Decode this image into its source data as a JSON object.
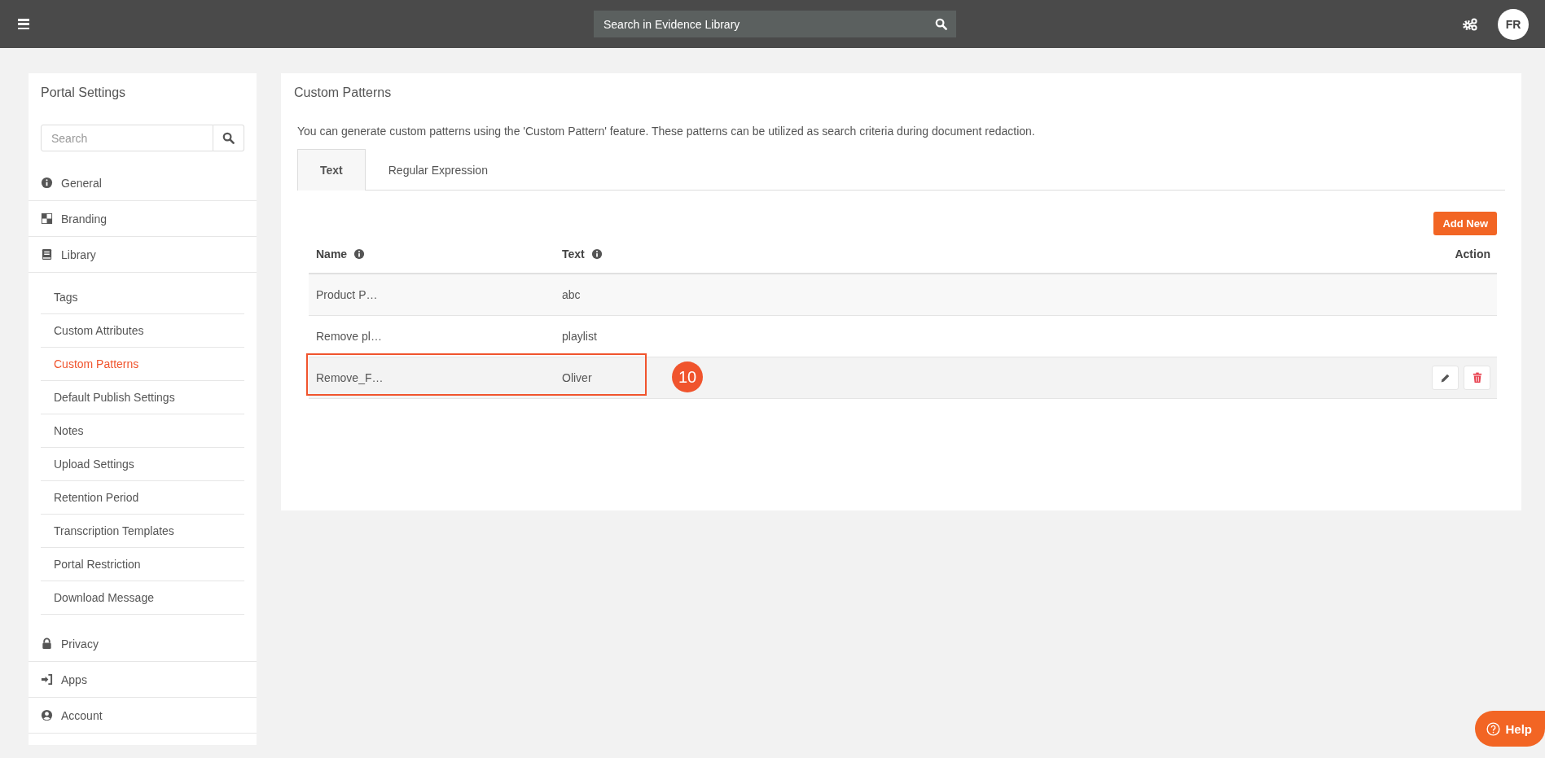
{
  "topbar": {
    "search": {
      "placeholder": "Search in Evidence Library"
    },
    "avatar": "FR"
  },
  "sidebar": {
    "title": "Portal Settings",
    "search": {
      "placeholder": "Search"
    },
    "items": [
      {
        "label": "General",
        "selected": false
      },
      {
        "label": "Branding",
        "selected": false
      },
      {
        "label": "Library",
        "selected": false,
        "children": [
          {
            "label": "Tags",
            "selected": false
          },
          {
            "label": "Custom Attributes",
            "selected": false
          },
          {
            "label": "Custom Patterns",
            "selected": true
          },
          {
            "label": "Default Publish Settings",
            "selected": false
          },
          {
            "label": "Notes",
            "selected": false
          },
          {
            "label": "Upload Settings",
            "selected": false
          },
          {
            "label": "Retention Period",
            "selected": false
          },
          {
            "label": "Transcription Templates",
            "selected": false
          },
          {
            "label": "Portal Restriction",
            "selected": false
          },
          {
            "label": "Download Message",
            "selected": false
          }
        ]
      },
      {
        "label": "Privacy",
        "selected": false
      },
      {
        "label": "Apps",
        "selected": false
      },
      {
        "label": "Account",
        "selected": false
      }
    ]
  },
  "main": {
    "title": "Custom Patterns",
    "description": "You can generate custom patterns using the 'Custom Pattern' feature. These patterns can be utilized as search criteria during document redaction.",
    "tabs": [
      {
        "label": "Text",
        "selected": true
      },
      {
        "label": "Regular Expression",
        "selected": false
      }
    ],
    "add_button": "Add New",
    "table": {
      "columns": [
        "Name",
        "Text",
        "Action"
      ],
      "rows": [
        {
          "name": "Product P…",
          "text": "abc",
          "actions_visible": false,
          "highlighted": false
        },
        {
          "name": "Remove pl…",
          "text": "playlist",
          "actions_visible": false,
          "highlighted": false
        },
        {
          "name": "Remove_F…",
          "text": "Oliver",
          "actions_visible": true,
          "highlighted": true,
          "annotation": "10"
        }
      ]
    }
  },
  "help_button": "Help"
}
